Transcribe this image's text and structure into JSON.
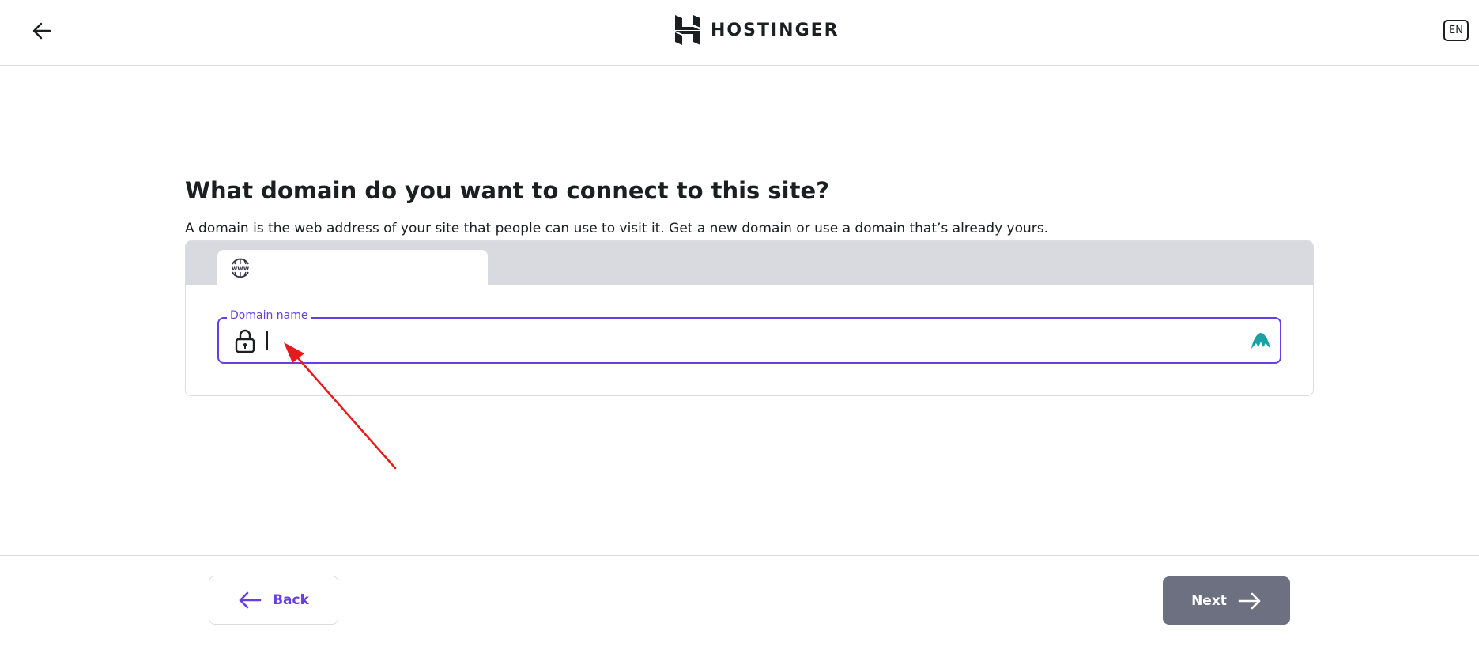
{
  "header": {
    "brand": "HOSTINGER",
    "language": "EN"
  },
  "icons": {
    "back_arrow": "arrow-left-icon",
    "logo": "hostinger-logo-icon",
    "www": "www-globe-icon",
    "lock": "lock-icon",
    "extension": "extension-mountain-icon",
    "back_button": "arrow-left-icon",
    "next_button": "arrow-right-icon"
  },
  "main": {
    "title": "What domain do you want to connect to this site?",
    "subtitle": "A domain is the web address of your site that people can use to visit it. Get a new domain or use a domain that’s already yours."
  },
  "domain_form": {
    "field_label": "Domain name",
    "value": "",
    "placeholder": ""
  },
  "footer": {
    "back_label": "Back",
    "next_label": "Next"
  },
  "colors": {
    "accent": "#673de6",
    "next_button_bg": "#6d7081",
    "tabbar_bg": "#d8dadf",
    "annotation_arrow": "#e8191a",
    "extension_icon": "#1ba0a6"
  }
}
